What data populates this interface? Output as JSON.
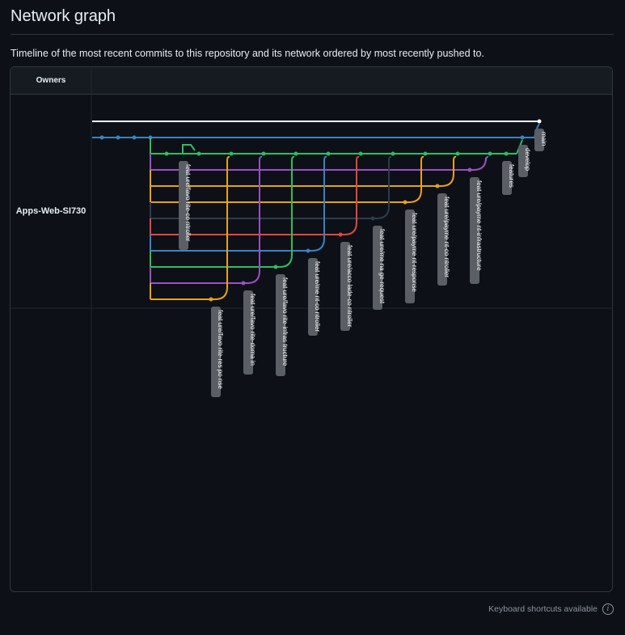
{
  "page": {
    "title": "Network graph",
    "description": "Timeline of the most recent commits to this repository and its network ordered by most recently pushed to."
  },
  "graph": {
    "owners_header": "Owners",
    "owner": "Apps-Web-SI730",
    "branches": [
      {
        "name": "main",
        "color": "#ffffff"
      },
      {
        "name": "develop",
        "color": "#3b82c4"
      },
      {
        "name": "features",
        "color": "#2dbe60"
      },
      {
        "name": "feat ure/favo rite-co ntroller",
        "color": "#2dbe60"
      },
      {
        "name": "feat ure/favo rite-res po nse",
        "color": "#e8a21a"
      },
      {
        "name": "feat ure/favo rite-doma in",
        "color": "#9b4fc4"
      },
      {
        "name": "feat ure/favo rite-infras tructure",
        "color": "#2dbe60"
      },
      {
        "name": "feat ure/me nt-co ntroller",
        "color": "#3b82c4"
      },
      {
        "name": "feat ure/acco lade-co ntroller",
        "color": "#e0483b"
      },
      {
        "name": "feat ure/me na ge-request",
        "color": "#2f3b4d"
      },
      {
        "name": "feat ure/payme nt-response",
        "color": "#e8a21a"
      },
      {
        "name": "feat ure/payme nt-co ntroller",
        "color": "#e8a21a"
      },
      {
        "name": "feat ure/payme nt-infrastructure",
        "color": "#9b4fc4"
      }
    ],
    "colors": {
      "background": "#0d1117",
      "label_bg": "#5a5f66",
      "grid": "#21262d"
    }
  },
  "footer": {
    "shortcuts": "Keyboard shortcuts available",
    "info_icon": "info-icon"
  }
}
